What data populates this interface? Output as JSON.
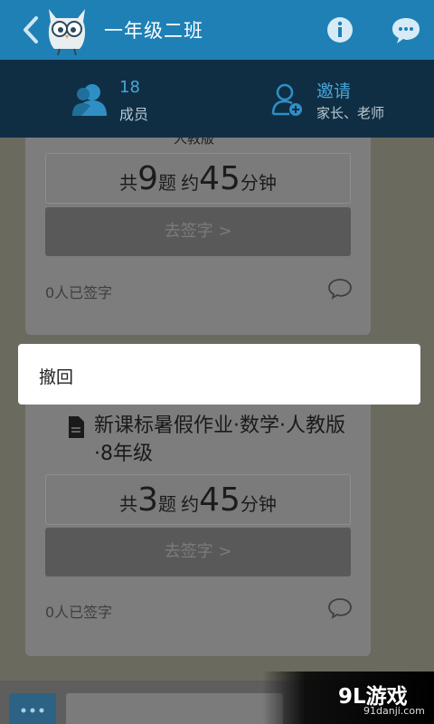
{
  "header": {
    "title": "一年级二班",
    "back_icon": "chevron-left-icon",
    "logo_icon": "owl-logo",
    "info_icon": "info-icon",
    "chat_icon": "chat-bubble-icon",
    "bg_color": "#1f80b5"
  },
  "subheader": {
    "members_count": "18",
    "members_label": "成员",
    "invite_title": "邀请",
    "invite_sub": "家长、老师",
    "bg_color": "#0f2e44"
  },
  "cards": [
    {
      "title_partial": "人教版",
      "count_prefix": "共",
      "question_count": "9",
      "question_unit": "题",
      "approx_label": "约",
      "minutes": "45",
      "minutes_unit": "分钟",
      "sign_button": "去签字 >",
      "signed_text": "0人已签字"
    },
    {
      "title": "新课标暑假作业·数学·人教版·8年级",
      "count_prefix": "共",
      "question_count": "3",
      "question_unit": "题",
      "approx_label": "约",
      "minutes": "45",
      "minutes_unit": "分钟",
      "sign_button": "去签字 >",
      "signed_text": "0人已签字"
    }
  ],
  "popup": {
    "item": "撤回"
  },
  "bottom": {
    "more_icon": "more-dots-icon"
  },
  "watermark": {
    "text": "9L游戏",
    "url": "91danji.com"
  }
}
